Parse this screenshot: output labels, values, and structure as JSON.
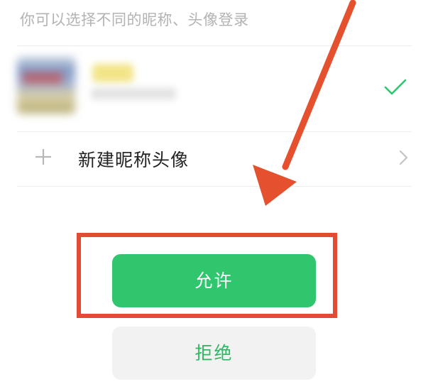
{
  "header": {
    "hint_text": "你可以选择不同的昵称、头像登录"
  },
  "account_option": {
    "selected": true,
    "check_icon": "check-icon"
  },
  "new_profile": {
    "label": "新建昵称头像",
    "plus_icon": "plus-icon",
    "chevron_icon": "chevron-right-icon"
  },
  "actions": {
    "allow_label": "允许",
    "deny_label": "拒绝"
  },
  "colors": {
    "accent_green": "#2fc66e",
    "deny_text_green": "#2fb863",
    "annotation_red": "#e34c32",
    "hint_gray": "#b3b3b3"
  }
}
